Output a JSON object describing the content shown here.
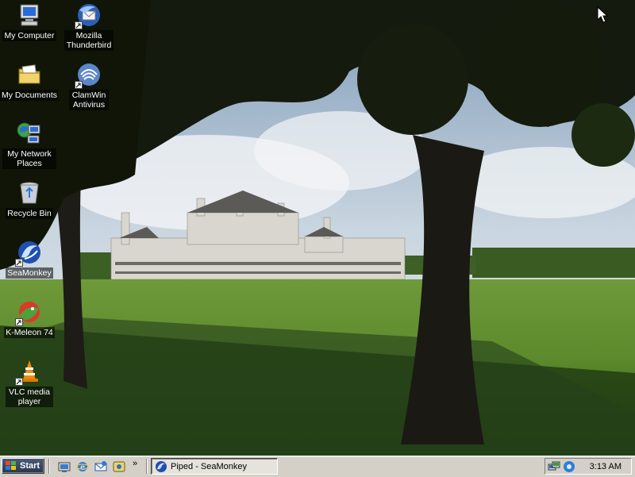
{
  "desktop": {
    "icons": [
      {
        "label": "My Computer",
        "icon": "my-computer-icon",
        "shortcut": false
      },
      {
        "label": "My Documents",
        "icon": "my-documents-icon",
        "shortcut": false
      },
      {
        "label": "My Network Places",
        "icon": "network-places-icon",
        "shortcut": false
      },
      {
        "label": "Recycle Bin",
        "icon": "recycle-bin-icon",
        "shortcut": false
      },
      {
        "label": "SeaMonkey",
        "icon": "seamonkey-icon",
        "shortcut": true
      },
      {
        "label": "K-Meleon 74",
        "icon": "k-meleon-icon",
        "shortcut": true
      },
      {
        "label": "VLC media player",
        "icon": "vlc-icon",
        "shortcut": true
      },
      {
        "label": "Mozilla Thunderbird",
        "icon": "thunderbird-icon",
        "shortcut": true
      },
      {
        "label": "ClamWin Antivirus",
        "icon": "clamwin-icon",
        "shortcut": true
      }
    ],
    "wallpaper": "Château de Chambord framed by trees on a lawn"
  },
  "taskbar": {
    "start_label": "Start",
    "quick_launch": [
      "show-desktop-icon",
      "internet-explorer-icon",
      "outlook-express-icon",
      "windows-media-icon"
    ],
    "more_chevron": "»",
    "tasks": [
      {
        "label": "Piped - SeaMonkey",
        "icon": "seamonkey-icon",
        "active": true
      }
    ],
    "tray_icons": [
      "network-tray-icon",
      "audio-tray-icon"
    ],
    "clock": "3:13 AM"
  },
  "colors": {
    "taskbar_bg": "#d4d0c8",
    "label_bg": "rgba(0,0,0,0.55)",
    "label_text": "#ffffff"
  }
}
